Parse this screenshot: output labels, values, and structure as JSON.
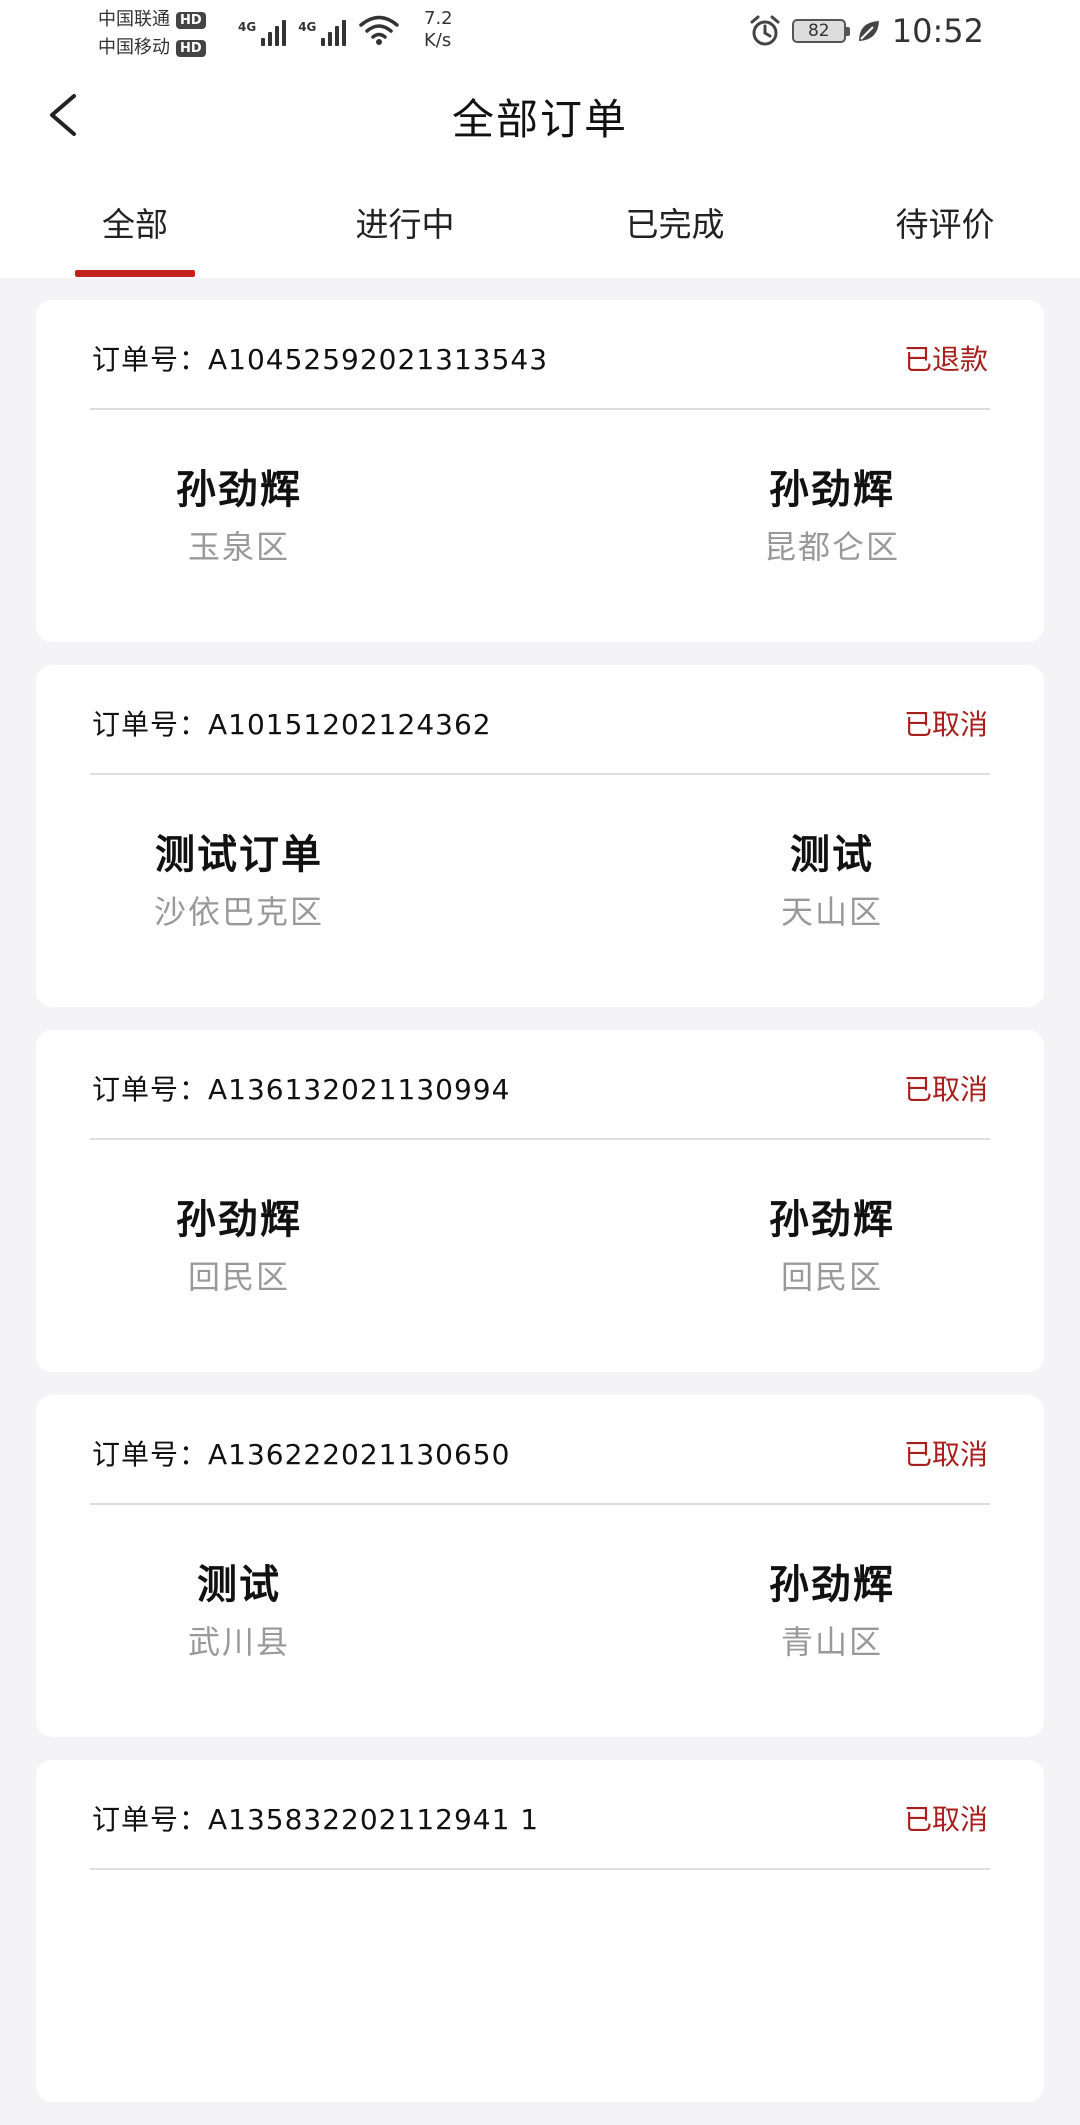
{
  "status_bar": {
    "carrier_1": "中国联通",
    "carrier_2": "中国移动",
    "hd_badge": "HD",
    "signal_label": "4G",
    "net_speed_value": "7.2",
    "net_speed_unit": "K/s",
    "battery": "82",
    "time": "10:52"
  },
  "header": {
    "title": "全部订单"
  },
  "tabs": [
    {
      "label": "全部",
      "active": true
    },
    {
      "label": "进行中",
      "active": false
    },
    {
      "label": "已完成",
      "active": false
    },
    {
      "label": "待评价",
      "active": false
    }
  ],
  "order_prefix": "订单号：",
  "orders": [
    {
      "order_no": "A10452592021313543",
      "status": "已退款",
      "from_name": "孙劲辉",
      "from_district": "玉泉区",
      "to_name": "孙劲辉",
      "to_district": "昆都仑区"
    },
    {
      "order_no": "A10151202124362",
      "status": "已取消",
      "from_name": "测试订单",
      "from_district": "沙依巴克区",
      "to_name": "测试",
      "to_district": "天山区"
    },
    {
      "order_no": "A136132021130994",
      "status": "已取消",
      "from_name": "孙劲辉",
      "from_district": "回民区",
      "to_name": "孙劲辉",
      "to_district": "回民区"
    },
    {
      "order_no": "A136222021130650",
      "status": "已取消",
      "from_name": "测试",
      "from_district": "武川县",
      "to_name": "孙劲辉",
      "to_district": "青山区"
    },
    {
      "order_no": "A135832202112941 1",
      "status": "已取消"
    }
  ],
  "colors": {
    "accent": "#c4211e",
    "status_text": "#a8201d",
    "background": "#f4f3f6"
  }
}
